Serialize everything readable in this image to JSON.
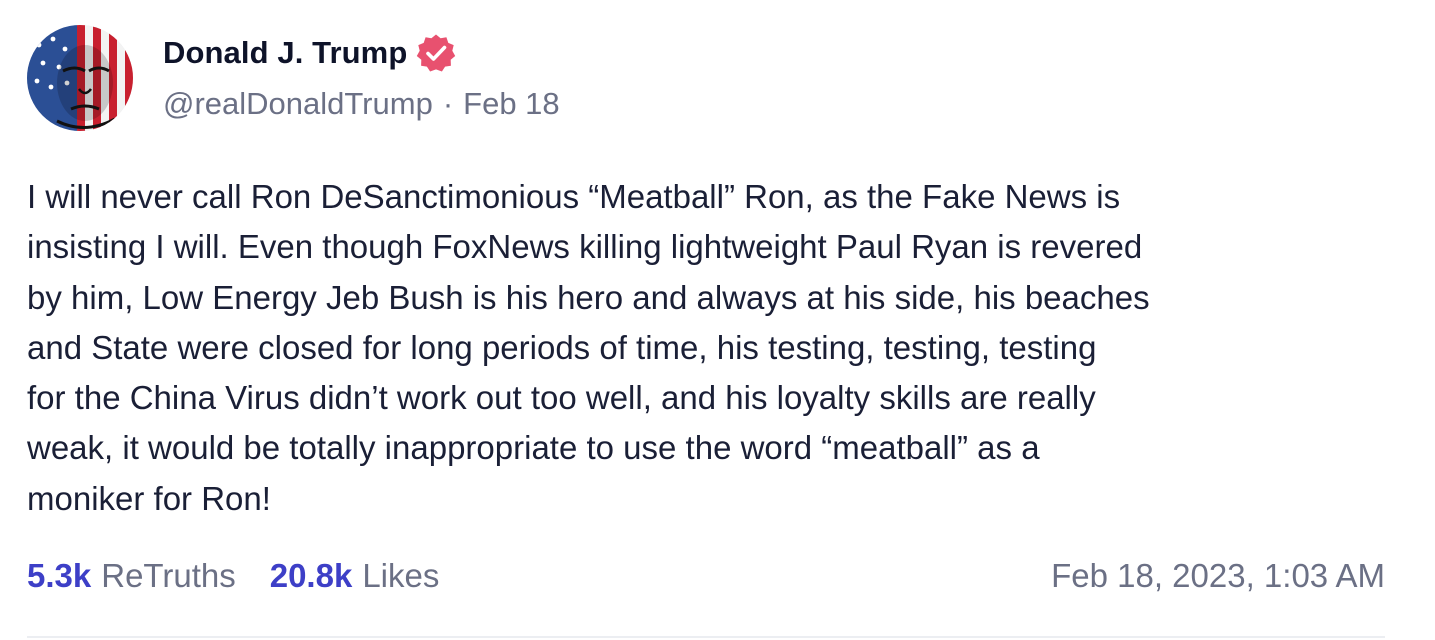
{
  "author": {
    "display_name": "Donald J. Trump",
    "handle": "@realDonaldTrump",
    "separator": "·",
    "relative_date": "Feb 18",
    "verified": true,
    "verified_color": "#e8516f"
  },
  "post": {
    "text": "I will never call Ron DeSanctimonious “Meatball” Ron, as the Fake News is\ninsisting I will. Even though FoxNews killing lightweight Paul Ryan is revered\nby him, Low Energy Jeb Bush is his hero and always at his side, his beaches\nand State were closed for long periods of time, his testing, testing, testing\nfor the China Virus didn’t work out too well, and his loyalty skills are really\nweak, it would be totally inappropriate to use the word “meatball” as a\nmoniker for Ron!"
  },
  "stats": {
    "retruths_count": "5.3k",
    "retruths_label": "ReTruths",
    "likes_count": "20.8k",
    "likes_label": "Likes"
  },
  "timestamp": "Feb 18, 2023, 1:03 AM",
  "colors": {
    "accent": "#3d3fc7",
    "muted": "#6b7085",
    "text": "#1a1f36"
  }
}
